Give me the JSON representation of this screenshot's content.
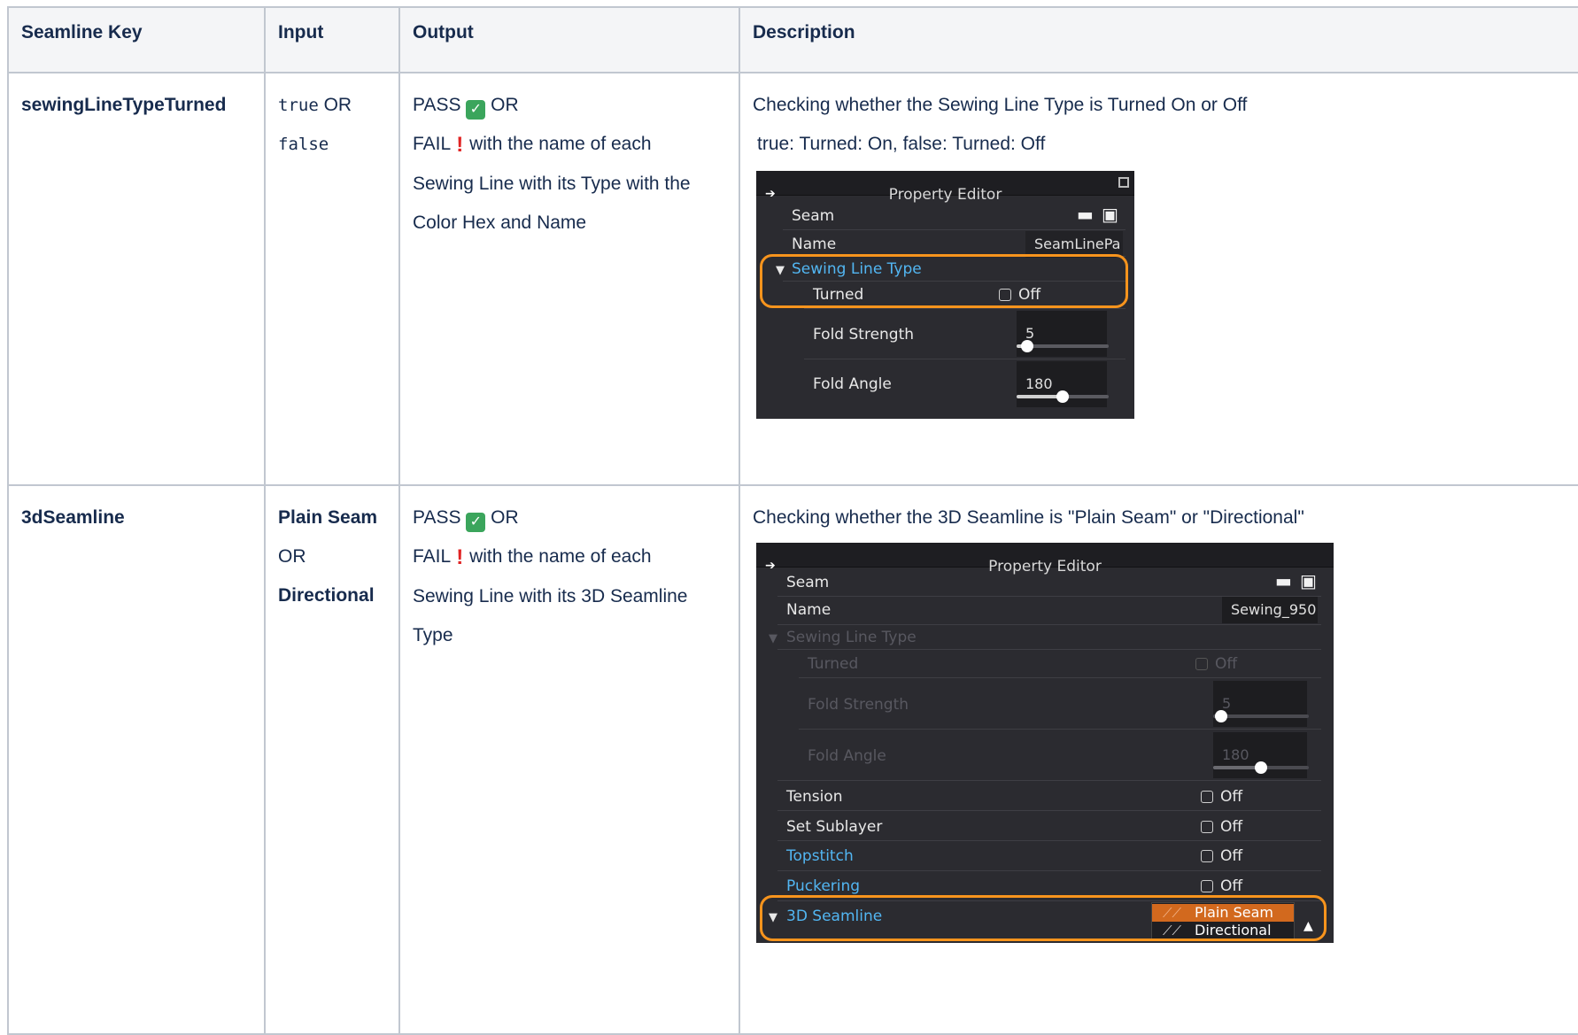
{
  "headers": [
    "Seamline Key",
    "Input",
    "Output",
    "Description"
  ],
  "rows": [
    {
      "key": "sewingLineTypeTurned",
      "input": {
        "code_true": "true",
        "or_word": " OR",
        "code_false": "false"
      },
      "output": {
        "pass": "PASS ",
        "or1": " OR",
        "fail": "FAIL ",
        "fail_rest": " with the name of each",
        "line3": "Sewing Line with its Type  with the",
        "line4": "Color Hex and Name"
      },
      "description": {
        "line1": "Checking whether the Sewing Line Type is Turned On or Off",
        "line2": "true: Turned: On, false: Turned: Off"
      },
      "editor": {
        "title": "Property Editor",
        "seam": "Seam",
        "name_label": "Name",
        "name_value": "SeamLinePa",
        "sewing_line_type": "Sewing Line Type",
        "turned": "Turned",
        "turned_value": "Off",
        "fold_strength": "Fold Strength",
        "fold_strength_value": "5",
        "fold_strength_level": 0.12,
        "fold_angle": "Fold Angle",
        "fold_angle_value": "180",
        "fold_angle_level": 0.5
      }
    },
    {
      "key": "3dSeamline",
      "input": {
        "opt1": "Plain Seam",
        "or_word": "OR",
        "opt2": "Directional"
      },
      "output": {
        "pass": "PASS ",
        "or1": " OR",
        "fail": "FAIL ",
        "fail_rest": " with the name of each",
        "line3": "Sewing Line with its 3D Seamline",
        "line4": "Type"
      },
      "description": {
        "line1": "Checking whether the 3D Seamline is \"Plain Seam\" or \"Directional\""
      },
      "editor": {
        "title": "Property Editor",
        "seam": "Seam",
        "name_label": "Name",
        "name_value": "Sewing_950",
        "sewing_line_type": "Sewing Line Type",
        "turned": "Turned",
        "turned_value": "Off",
        "fold_strength": "Fold Strength",
        "fold_strength_value": "5",
        "fold_strength_level": 0.08,
        "fold_angle": "Fold Angle",
        "fold_angle_value": "180",
        "fold_angle_level": 0.5,
        "tension": "Tension",
        "tension_value": "Off",
        "set_sublayer": "Set Sublayer",
        "set_sublayer_value": "Off",
        "topstitch": "Topstitch",
        "topstitch_value": "Off",
        "puckering": "Puckering",
        "puckering_value": "Off",
        "seamline_3d": "3D Seamline",
        "options": [
          "Plain Seam",
          "Directional"
        ]
      }
    }
  ],
  "icons": {
    "pass": "check-mark-emoji",
    "fail": "exclamation-emoji"
  },
  "colors": {
    "highlight": "#f7941d",
    "link_blue": "#52b6f2",
    "selected_option": "#d2691e",
    "header_bg": "#f4f5f7"
  }
}
